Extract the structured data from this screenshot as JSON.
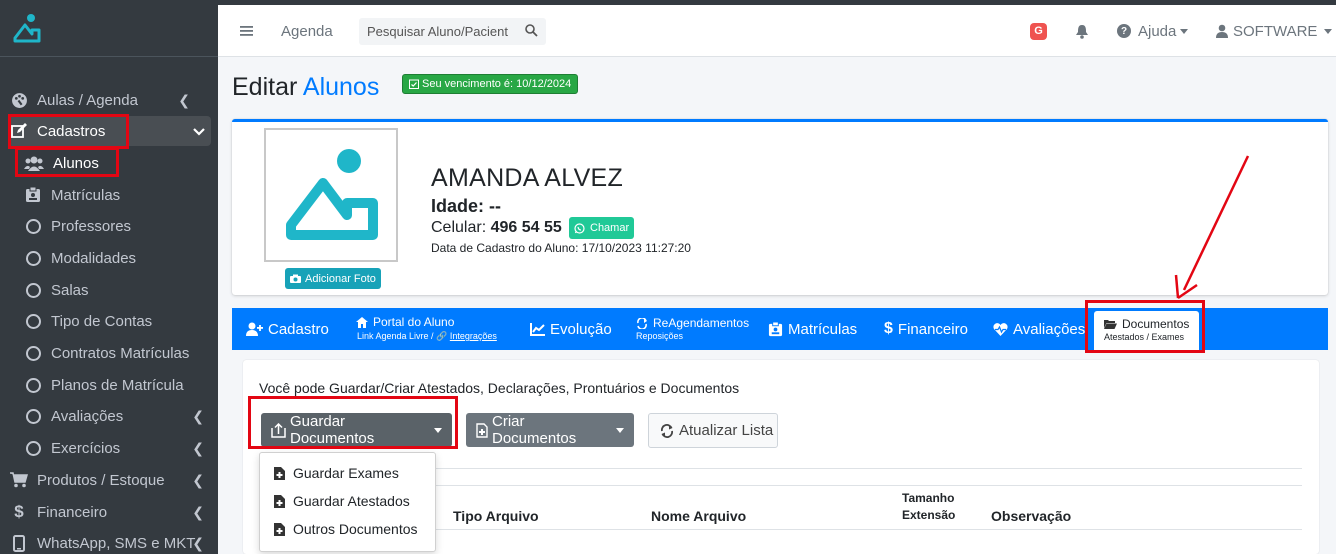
{
  "brand": {
    "logo_icon": "app-logo-icon"
  },
  "sidebar": {
    "items": [
      {
        "label": "Aulas / Agenda",
        "icon": "palette-icon"
      },
      {
        "label": "Cadastros",
        "icon": "edit-icon"
      },
      {
        "label": "Alunos",
        "icon": "users-icon"
      },
      {
        "label": "Matrículas",
        "icon": "id-badge-icon"
      },
      {
        "label": "Professores",
        "icon": "circle-icon"
      },
      {
        "label": "Modalidades",
        "icon": "circle-icon"
      },
      {
        "label": "Salas",
        "icon": "circle-icon"
      },
      {
        "label": "Tipo de Contas",
        "icon": "circle-icon"
      },
      {
        "label": "Contratos Matrículas",
        "icon": "circle-icon"
      },
      {
        "label": "Planos de Matrícula",
        "icon": "circle-icon"
      },
      {
        "label": "Avaliações",
        "icon": "circle-icon"
      },
      {
        "label": "Exercícios",
        "icon": "circle-icon"
      },
      {
        "label": "Produtos / Estoque",
        "icon": "cart-icon"
      },
      {
        "label": "Financeiro",
        "icon": "dollar-icon"
      },
      {
        "label": "WhatsApp, SMS e MKT",
        "icon": "mobile-icon"
      }
    ]
  },
  "topbar": {
    "agenda": "Agenda",
    "search_placeholder": "Pesquisar Aluno/Pacient",
    "g_badge": "G",
    "help": "Ajuda",
    "user": "SOFTWARE"
  },
  "page": {
    "title_prefix": "Editar",
    "title_highlight": "Alunos",
    "due_badge": "Seu vencimento é: 10/12/2024"
  },
  "student": {
    "add_photo": "Adicionar Foto",
    "name": "AMANDA ALVEZ",
    "age_label": "Idade:",
    "age_value": "--",
    "phone_label": "Celular:",
    "phone_value": "496 54 55",
    "whatsapp_button": "Chamar",
    "registration": "Data de Cadastro do Aluno: 17/10/2023 11:27:20"
  },
  "tabs": [
    {
      "label": "Cadastro"
    },
    {
      "label": "Portal do Aluno",
      "sub1": "Link Agenda Livre /",
      "sub2": "Integrações"
    },
    {
      "label": "Evolução"
    },
    {
      "label": "ReAgendamentos",
      "sub": "Reposições"
    },
    {
      "label": "Matrículas"
    },
    {
      "label": "Financeiro"
    },
    {
      "label": "Avaliações"
    },
    {
      "label": "Documentos",
      "sub": "Atestados / Exames"
    }
  ],
  "documents": {
    "intro": "Você pode Guardar/Criar Atestados, Declarações, Prontuários e Documentos",
    "store_button": "Guardar Documentos",
    "create_button": "Criar Documentos",
    "refresh_button": "Atualizar Lista",
    "dropdown": [
      "Guardar Exames",
      "Guardar Atestados",
      "Outros Documentos"
    ],
    "columns": {
      "tipo": "Tipo Arquivo",
      "nome": "Nome Arquivo",
      "tamanho": "Tamanho",
      "extensao": "Extensão",
      "observacao": "Observação"
    }
  },
  "colors": {
    "sidebar_bg": "#343a40",
    "primary": "#007bff",
    "success": "#28a745",
    "info": "#17a2b8",
    "secondary": "#6c757d",
    "highlight": "#e30613",
    "logo": "#1fb6c9"
  }
}
